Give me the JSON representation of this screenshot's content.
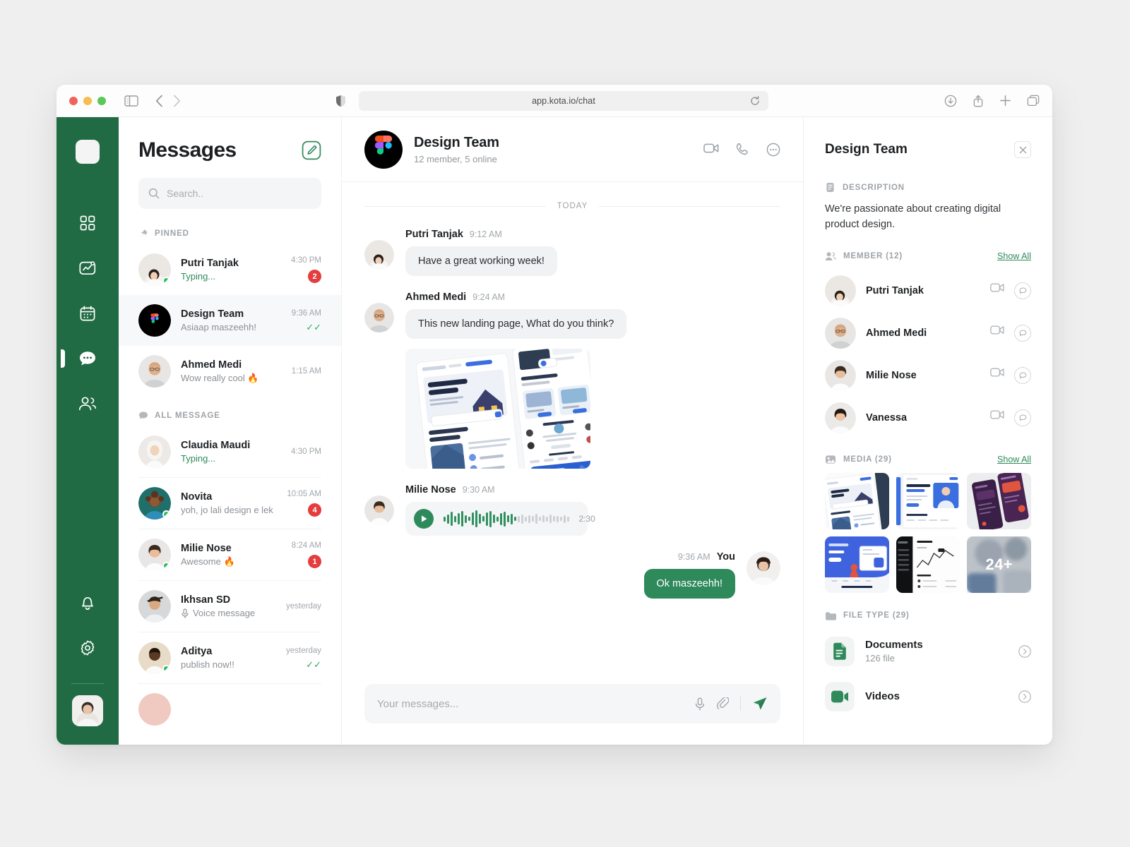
{
  "browser": {
    "url": "app.kota.io/chat",
    "icons": {
      "sidebar_toggle": "sidebar-toggle-icon",
      "back": "back-arrow-icon",
      "forward": "forward-arrow-icon",
      "shield": "shield-icon",
      "reload": "reload-icon",
      "download": "download-icon",
      "share": "share-icon",
      "new_tab": "plus-icon",
      "tabs": "tabs-overview-icon"
    }
  },
  "rail": {
    "items": [
      {
        "name": "logo",
        "icon": "app-logo-icon",
        "active": false
      },
      {
        "name": "dashboard",
        "icon": "grid-icon",
        "active": false
      },
      {
        "name": "analytics",
        "icon": "chart-icon",
        "active": false
      },
      {
        "name": "calendar",
        "icon": "calendar-icon",
        "active": false
      },
      {
        "name": "messages",
        "icon": "chat-bubble-icon",
        "active": true
      },
      {
        "name": "contacts",
        "icon": "people-icon",
        "active": false
      },
      {
        "name": "notifications",
        "icon": "bell-icon",
        "active": false
      },
      {
        "name": "settings",
        "icon": "gear-icon",
        "active": false
      }
    ]
  },
  "list": {
    "title": "Messages",
    "compose_icon": "compose-icon",
    "search": {
      "placeholder": "Search..",
      "value": "",
      "icon": "search-icon"
    },
    "pinned_label": "PINNED",
    "all_label": "ALL MESSAGE",
    "pinned": [
      {
        "name": "Putri Tanjak",
        "preview": "Typing...",
        "time": "4:30 PM",
        "badge": "2",
        "typing": true,
        "online": true,
        "active": false,
        "read": false
      },
      {
        "name": "Design Team",
        "preview": "Asiaap maszeehh!",
        "time": "9:36 AM",
        "badge": "",
        "typing": false,
        "online": false,
        "active": true,
        "read": true
      },
      {
        "name": "Ahmed Medi",
        "preview": "Wow really cool 🔥",
        "time": "1:15 AM",
        "badge": "",
        "typing": false,
        "online": false,
        "active": false,
        "read": false
      }
    ],
    "all": [
      {
        "name": "Claudia Maudi",
        "preview": "Typing...",
        "time": "4:30 PM",
        "badge": "",
        "typing": true,
        "online": false,
        "read": false
      },
      {
        "name": "Novita",
        "preview": "yoh, jo lali design e lek",
        "time": "10:05 AM",
        "badge": "4",
        "typing": false,
        "online": true,
        "read": false
      },
      {
        "name": "Milie Nose",
        "preview": "Awesome 🔥",
        "time": "8:24 AM",
        "badge": "1",
        "typing": false,
        "online": true,
        "read": false
      },
      {
        "name": "Ikhsan SD",
        "preview": "Voice message",
        "time": "yesterday",
        "badge": "",
        "typing": false,
        "online": false,
        "read": false,
        "voice": true
      },
      {
        "name": "Aditya",
        "preview": "publish now!!",
        "time": "yesterday",
        "badge": "",
        "typing": false,
        "online": true,
        "read": true
      }
    ]
  },
  "chat": {
    "title": "Design Team",
    "subtitle": "12 member, 5 online",
    "actions": [
      "video-call-icon",
      "phone-call-icon",
      "more-options-icon"
    ],
    "day_separator": "TODAY",
    "messages": [
      {
        "author": "Putri Tanjak",
        "time": "9:12 AM",
        "text": "Have a great working week!",
        "type": "text",
        "out": false
      },
      {
        "author": "Ahmed Medi",
        "time": "9:24 AM",
        "text": "This new landing page, What do you think?",
        "type": "image",
        "out": false,
        "attachment": "landing-page-mockup"
      },
      {
        "author": "Milie Nose",
        "time": "9:30 AM",
        "text": "",
        "type": "voice",
        "out": false,
        "duration": "2:30"
      },
      {
        "author": "You",
        "time": "9:36 AM",
        "text": "Ok maszeehh!",
        "type": "text",
        "out": true
      }
    ],
    "composer": {
      "placeholder": "Your messages...",
      "value": "",
      "mic_icon": "microphone-icon",
      "attach_icon": "paperclip-icon",
      "send_icon": "send-icon"
    }
  },
  "info": {
    "title": "Design Team",
    "close_icon": "close-icon",
    "description_label": "DESCRIPTION",
    "description": "We're passionate about creating digital product design.",
    "member_label": "MEMBER (12)",
    "member_showall": "Show All",
    "members": [
      {
        "name": "Putri Tanjak"
      },
      {
        "name": "Ahmed Medi"
      },
      {
        "name": "Milie Nose"
      },
      {
        "name": "Vanessa"
      }
    ],
    "media_label": "MEDIA (29)",
    "media_showall": "Show All",
    "media": [
      {
        "alt": "real-estate-landing-thumb",
        "overlay": ""
      },
      {
        "alt": "job-portal-landing-thumb",
        "overlay": ""
      },
      {
        "alt": "mobile-app-dark-thumb",
        "overlay": ""
      },
      {
        "alt": "blue-saas-landing-thumb",
        "overlay": ""
      },
      {
        "alt": "dark-dashboard-thumb",
        "overlay": ""
      },
      {
        "alt": "more-media-thumb",
        "overlay": "24+"
      }
    ],
    "filetype_label": "FILE TYPE (29)",
    "files": [
      {
        "name": "Documents",
        "count": "126 file",
        "icon": "document-icon"
      },
      {
        "name": "Videos",
        "count": "",
        "icon": "video-icon"
      }
    ]
  },
  "colors": {
    "brand_green": "#216b44",
    "accent_green": "#2f8a5b",
    "badge_red": "#e33d3d",
    "online_green": "#2bbf5e"
  }
}
